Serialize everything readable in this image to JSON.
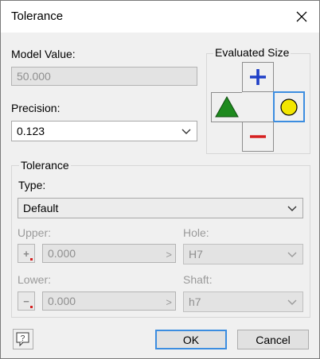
{
  "window": {
    "title": "Tolerance"
  },
  "model_value": {
    "label": "Model Value:",
    "value": "50.000"
  },
  "precision": {
    "label": "Precision:",
    "value": "0.123"
  },
  "evaluated_size": {
    "label": "Evaluated Size",
    "selected": "max-circle",
    "colors": {
      "plus": "#1f3fc7",
      "minus": "#d62020",
      "triangle": "#1e8a1e",
      "circle": "#f3e600"
    }
  },
  "tolerance": {
    "group_label": "Tolerance",
    "type_label": "Type:",
    "type_value": "Default",
    "upper_label": "Upper:",
    "upper_value": "0.000",
    "lower_label": "Lower:",
    "lower_value": "0.000",
    "hole_label": "Hole:",
    "hole_value": "H7",
    "shaft_label": "Shaft:",
    "shaft_value": "h7"
  },
  "buttons": {
    "ok": "OK",
    "cancel": "Cancel"
  }
}
